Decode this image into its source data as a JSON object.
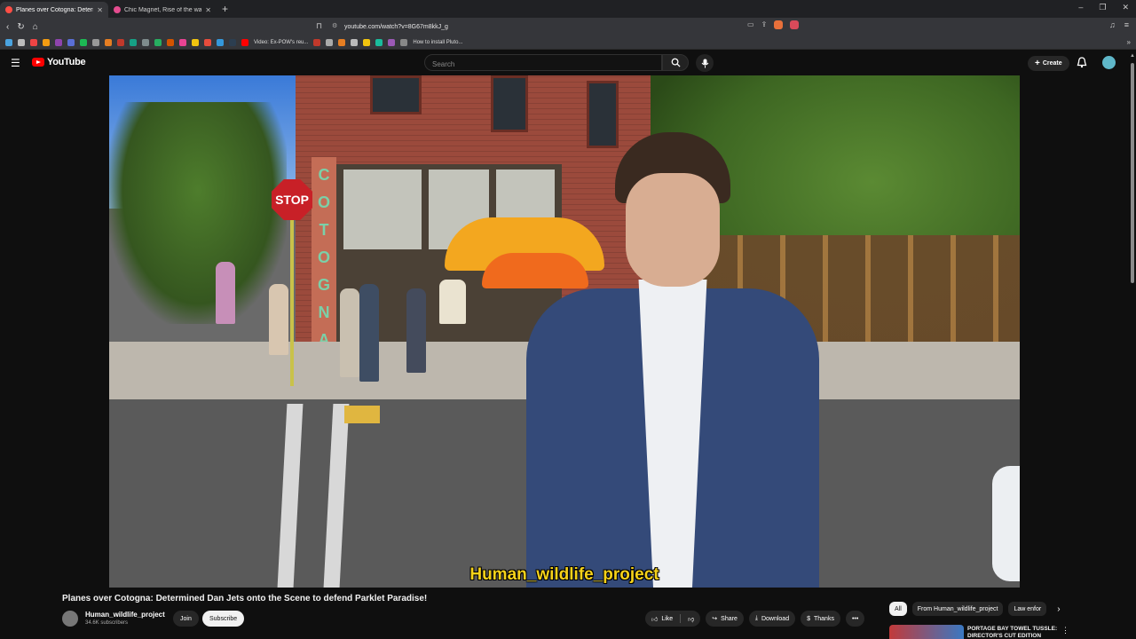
{
  "browser": {
    "tabs": [
      {
        "title": "Planes over Cotogna: Determ",
        "active": true
      },
      {
        "title": "Chic Magnet, Rise of the warrior won",
        "active": false
      }
    ],
    "url": "youtube.com/watch?v=8G67m8kkJ_g",
    "bookmarks": {
      "videos_label": "Video: Ex-POW's reu...",
      "install_label": "How to install Pluto..."
    }
  },
  "youtube": {
    "logo_text": "YouTube",
    "search_placeholder": "Search",
    "create_label": "Create"
  },
  "video": {
    "caption": "Human_wildlife_project",
    "title": "Planes over Cotogna: Determined Dan Jets onto the Scene to defend Parklet Paradise!",
    "scene_text": {
      "stop_sign": "STOP",
      "storefront_sign": [
        "C",
        "O",
        "T",
        "O",
        "G",
        "N",
        "A"
      ]
    }
  },
  "channel": {
    "name": "Human_wildlife_project",
    "subscribers": "34.6K subscribers",
    "join_label": "Join",
    "subscribe_label": "Subscribe"
  },
  "actions": {
    "like": "Like",
    "share": "Share",
    "download": "Download",
    "thanks": "Thanks"
  },
  "chips": [
    "All",
    "From Human_wildlife_project",
    "Law enfor"
  ],
  "recommendation": {
    "title": "PORTAGE BAY TOWEL TUSSLE: DIRECTOR'S CUT EDITION"
  },
  "colors": {
    "youtube_red": "#ff0000",
    "caption_yellow": "#f6d21a",
    "background": "#0f0f0f"
  }
}
